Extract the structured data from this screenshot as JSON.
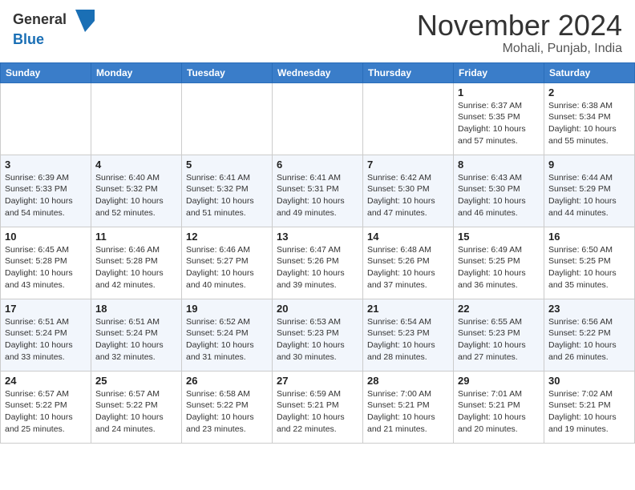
{
  "header": {
    "logo_general": "General",
    "logo_blue": "Blue",
    "month_title": "November 2024",
    "subtitle": "Mohali, Punjab, India"
  },
  "calendar": {
    "days_of_week": [
      "Sunday",
      "Monday",
      "Tuesday",
      "Wednesday",
      "Thursday",
      "Friday",
      "Saturday"
    ],
    "weeks": [
      [
        {
          "day": "",
          "info": ""
        },
        {
          "day": "",
          "info": ""
        },
        {
          "day": "",
          "info": ""
        },
        {
          "day": "",
          "info": ""
        },
        {
          "day": "",
          "info": ""
        },
        {
          "day": "1",
          "info": "Sunrise: 6:37 AM\nSunset: 5:35 PM\nDaylight: 10 hours and 57 minutes."
        },
        {
          "day": "2",
          "info": "Sunrise: 6:38 AM\nSunset: 5:34 PM\nDaylight: 10 hours and 55 minutes."
        }
      ],
      [
        {
          "day": "3",
          "info": "Sunrise: 6:39 AM\nSunset: 5:33 PM\nDaylight: 10 hours and 54 minutes."
        },
        {
          "day": "4",
          "info": "Sunrise: 6:40 AM\nSunset: 5:32 PM\nDaylight: 10 hours and 52 minutes."
        },
        {
          "day": "5",
          "info": "Sunrise: 6:41 AM\nSunset: 5:32 PM\nDaylight: 10 hours and 51 minutes."
        },
        {
          "day": "6",
          "info": "Sunrise: 6:41 AM\nSunset: 5:31 PM\nDaylight: 10 hours and 49 minutes."
        },
        {
          "day": "7",
          "info": "Sunrise: 6:42 AM\nSunset: 5:30 PM\nDaylight: 10 hours and 47 minutes."
        },
        {
          "day": "8",
          "info": "Sunrise: 6:43 AM\nSunset: 5:30 PM\nDaylight: 10 hours and 46 minutes."
        },
        {
          "day": "9",
          "info": "Sunrise: 6:44 AM\nSunset: 5:29 PM\nDaylight: 10 hours and 44 minutes."
        }
      ],
      [
        {
          "day": "10",
          "info": "Sunrise: 6:45 AM\nSunset: 5:28 PM\nDaylight: 10 hours and 43 minutes."
        },
        {
          "day": "11",
          "info": "Sunrise: 6:46 AM\nSunset: 5:28 PM\nDaylight: 10 hours and 42 minutes."
        },
        {
          "day": "12",
          "info": "Sunrise: 6:46 AM\nSunset: 5:27 PM\nDaylight: 10 hours and 40 minutes."
        },
        {
          "day": "13",
          "info": "Sunrise: 6:47 AM\nSunset: 5:26 PM\nDaylight: 10 hours and 39 minutes."
        },
        {
          "day": "14",
          "info": "Sunrise: 6:48 AM\nSunset: 5:26 PM\nDaylight: 10 hours and 37 minutes."
        },
        {
          "day": "15",
          "info": "Sunrise: 6:49 AM\nSunset: 5:25 PM\nDaylight: 10 hours and 36 minutes."
        },
        {
          "day": "16",
          "info": "Sunrise: 6:50 AM\nSunset: 5:25 PM\nDaylight: 10 hours and 35 minutes."
        }
      ],
      [
        {
          "day": "17",
          "info": "Sunrise: 6:51 AM\nSunset: 5:24 PM\nDaylight: 10 hours and 33 minutes."
        },
        {
          "day": "18",
          "info": "Sunrise: 6:51 AM\nSunset: 5:24 PM\nDaylight: 10 hours and 32 minutes."
        },
        {
          "day": "19",
          "info": "Sunrise: 6:52 AM\nSunset: 5:24 PM\nDaylight: 10 hours and 31 minutes."
        },
        {
          "day": "20",
          "info": "Sunrise: 6:53 AM\nSunset: 5:23 PM\nDaylight: 10 hours and 30 minutes."
        },
        {
          "day": "21",
          "info": "Sunrise: 6:54 AM\nSunset: 5:23 PM\nDaylight: 10 hours and 28 minutes."
        },
        {
          "day": "22",
          "info": "Sunrise: 6:55 AM\nSunset: 5:23 PM\nDaylight: 10 hours and 27 minutes."
        },
        {
          "day": "23",
          "info": "Sunrise: 6:56 AM\nSunset: 5:22 PM\nDaylight: 10 hours and 26 minutes."
        }
      ],
      [
        {
          "day": "24",
          "info": "Sunrise: 6:57 AM\nSunset: 5:22 PM\nDaylight: 10 hours and 25 minutes."
        },
        {
          "day": "25",
          "info": "Sunrise: 6:57 AM\nSunset: 5:22 PM\nDaylight: 10 hours and 24 minutes."
        },
        {
          "day": "26",
          "info": "Sunrise: 6:58 AM\nSunset: 5:22 PM\nDaylight: 10 hours and 23 minutes."
        },
        {
          "day": "27",
          "info": "Sunrise: 6:59 AM\nSunset: 5:21 PM\nDaylight: 10 hours and 22 minutes."
        },
        {
          "day": "28",
          "info": "Sunrise: 7:00 AM\nSunset: 5:21 PM\nDaylight: 10 hours and 21 minutes."
        },
        {
          "day": "29",
          "info": "Sunrise: 7:01 AM\nSunset: 5:21 PM\nDaylight: 10 hours and 20 minutes."
        },
        {
          "day": "30",
          "info": "Sunrise: 7:02 AM\nSunset: 5:21 PM\nDaylight: 10 hours and 19 minutes."
        }
      ]
    ]
  }
}
